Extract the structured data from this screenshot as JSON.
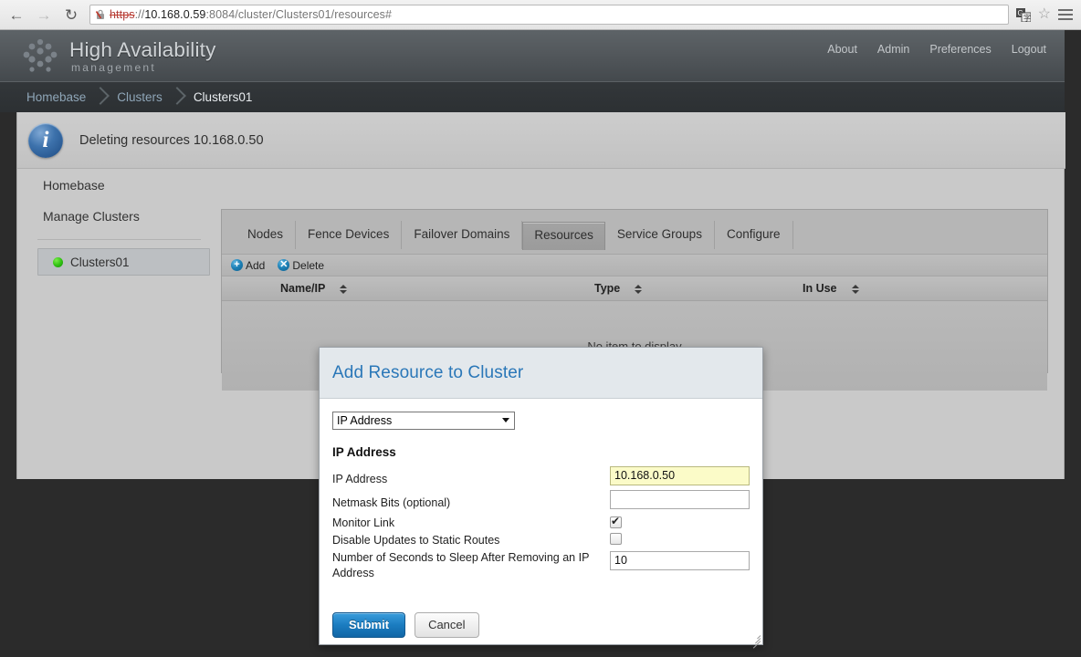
{
  "browser": {
    "back_icon": "back-arrow-icon",
    "forward_icon": "forward-arrow-icon",
    "reload_icon": "reload-icon",
    "security_icon": "insecure-lock-icon",
    "url_scheme": "https",
    "url_separator": "://",
    "url_host": "10.168.0.59",
    "url_rest": ":8084/cluster/Clusters01/resources#",
    "translate_icon": "translate-icon",
    "bookmark_icon": "star-icon",
    "menu_icon": "hamburger-menu-icon"
  },
  "masthead": {
    "logo_icon": "cluster-dots-logo",
    "title": "High Availability",
    "subtitle": "management",
    "nav": [
      {
        "label": "About"
      },
      {
        "label": "Admin"
      },
      {
        "label": "Preferences"
      },
      {
        "label": "Logout"
      }
    ]
  },
  "breadcrumb": [
    {
      "label": "Homebase"
    },
    {
      "label": "Clusters"
    },
    {
      "label": "Clusters01"
    }
  ],
  "notice": {
    "icon": "info-icon",
    "text": "Deleting resources 10.168.0.50"
  },
  "sidebar": {
    "links": [
      {
        "label": "Homebase"
      },
      {
        "label": "Manage Clusters"
      }
    ],
    "cluster": {
      "label": "Clusters01",
      "status_icon": "green-status-dot"
    }
  },
  "tabs": [
    {
      "label": "Nodes",
      "active": false
    },
    {
      "label": "Fence Devices",
      "active": false
    },
    {
      "label": "Failover Domains",
      "active": false
    },
    {
      "label": "Resources",
      "active": true
    },
    {
      "label": "Service Groups",
      "active": false
    },
    {
      "label": "Configure",
      "active": false
    }
  ],
  "toolbar": {
    "add_label": "Add",
    "add_icon": "plus-circle-icon",
    "delete_label": "Delete",
    "delete_icon": "x-circle-icon"
  },
  "table": {
    "columns": [
      {
        "label": "Name/IP",
        "sort_icon": "sort-arrows-icon"
      },
      {
        "label": "Type",
        "sort_icon": "sort-arrows-icon"
      },
      {
        "label": "In Use",
        "sort_icon": "sort-arrows-icon"
      }
    ],
    "rows": [],
    "empty_text": "No item to display"
  },
  "modal": {
    "title": "Add Resource to Cluster",
    "resource_type": {
      "selected": "IP Address",
      "caret_icon": "chevron-down-icon"
    },
    "section_title": "IP Address",
    "fields": [
      {
        "label": "IP Address",
        "value": "10.168.0.50",
        "type": "text",
        "autofill": true
      },
      {
        "label": "Netmask Bits (optional)",
        "value": "",
        "type": "text",
        "autofill": false
      },
      {
        "label": "Monitor Link",
        "value": "",
        "type": "checkbox",
        "checked": true
      },
      {
        "label": "Disable Updates to Static Routes",
        "value": "",
        "type": "checkbox",
        "checked": false
      },
      {
        "label": "Number of Seconds to Sleep After Removing an IP Address",
        "value": "10",
        "type": "text",
        "autofill": false
      }
    ],
    "submit_label": "Submit",
    "cancel_label": "Cancel",
    "resize_icon": "resize-grip-icon"
  }
}
